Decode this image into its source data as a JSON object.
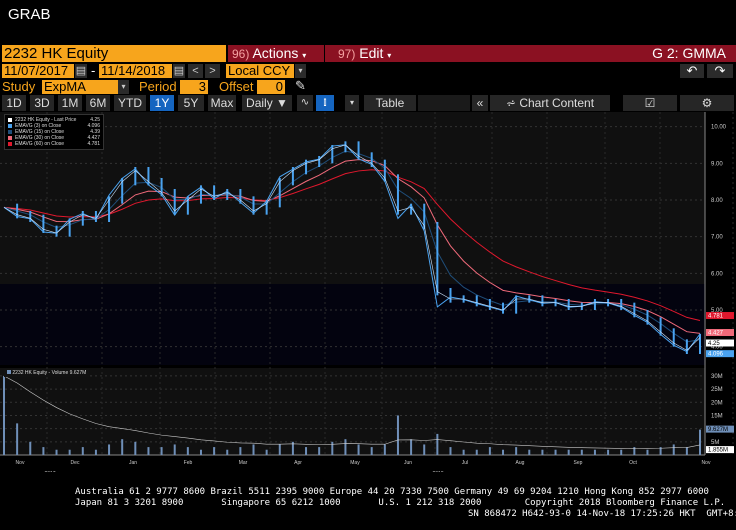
{
  "window_title": "GRAB",
  "security": "2232 HK Equity",
  "menu": {
    "actions_num": "96)",
    "actions": "Actions",
    "edit_num": "97)",
    "edit": "Edit",
    "screen": "G 2: GMMA"
  },
  "dates": {
    "start": "11/07/2017",
    "end": "11/14/2018",
    "currency": "Local CCY"
  },
  "study": {
    "label": "Study",
    "value": "ExpMA",
    "period_label": "Period",
    "period": "3",
    "offset_label": "Offset",
    "offset": "0"
  },
  "toolbar": {
    "ranges": [
      "1D",
      "3D",
      "1M",
      "6M",
      "YTD",
      "1Y",
      "5Y",
      "Max"
    ],
    "selected": "1Y",
    "frequency": "Daily ▼",
    "table": "Table",
    "chart_content": "Chart Content"
  },
  "legend": {
    "items": [
      {
        "label": "2232 HK Equity - Last Price",
        "value": "4.25",
        "color": "#ffffff"
      },
      {
        "label": "EMAVG (3) on Close",
        "value": "4.096",
        "color": "#4aa3f0"
      },
      {
        "label": "EMAVG (15) on Close",
        "value": "4.39",
        "color": "#1f4e7a"
      },
      {
        "label": "EMAVG (30) on Close",
        "value": "4.427",
        "color": "#f06a7a"
      },
      {
        "label": "EMAVG (60) on Close",
        "value": "4.781",
        "color": "#e0182d"
      }
    ]
  },
  "volume_legend": {
    "label": "2232 HK Equity - Volume",
    "value": "9.627M"
  },
  "chart_data": {
    "type": "line",
    "price_axis": {
      "ylim": [
        3.5,
        10.4
      ],
      "ticks": [
        "10.00",
        "9.00",
        "8.00",
        "7.00",
        "6.00",
        "5.00",
        "4.00"
      ]
    },
    "volume_axis": {
      "ylim": [
        0,
        33
      ],
      "ticks": [
        "30M",
        "25M",
        "20M",
        "15M",
        "10M",
        "5M"
      ]
    },
    "x_months": [
      "Nov",
      "Dec",
      "Jan",
      "Feb",
      "Mar",
      "Apr",
      "May",
      "Jun",
      "Jul",
      "Aug",
      "Sep",
      "Oct",
      "Nov"
    ],
    "year_labels": [
      {
        "month": "Nov",
        "year": "2017"
      },
      {
        "month": "Jun",
        "year": "2018"
      }
    ],
    "close": [
      7.8,
      7.6,
      7.5,
      7.2,
      7.1,
      7.4,
      7.6,
      7.5,
      8.0,
      8.5,
      8.8,
      8.5,
      8.2,
      7.7,
      8.0,
      8.3,
      8.1,
      8.2,
      8.0,
      7.7,
      7.9,
      8.5,
      8.8,
      9.0,
      9.1,
      9.4,
      9.5,
      9.2,
      9.0,
      8.6,
      7.7,
      7.8,
      7.3,
      5.5,
      5.3,
      5.3,
      5.2,
      5.1,
      5.0,
      5.3,
      5.3,
      5.2,
      5.2,
      5.1,
      5.1,
      5.2,
      5.2,
      5.1,
      4.9,
      4.7,
      4.4,
      4.1,
      3.9,
      4.25
    ],
    "volume": [
      30,
      12,
      5,
      3,
      2,
      2,
      3,
      2,
      4,
      6,
      5,
      3,
      3,
      4,
      3,
      2,
      3,
      2,
      3,
      4,
      2,
      4,
      5,
      3,
      3,
      5,
      6,
      4,
      3,
      4,
      15,
      6,
      4,
      8,
      3,
      2,
      2,
      3,
      2,
      3,
      2,
      2,
      2,
      2,
      2,
      2,
      2,
      2,
      3,
      2,
      3,
      4,
      3,
      9.627
    ],
    "value_tags": [
      {
        "value": "4.781",
        "color": "#e0182d"
      },
      {
        "value": "4.427",
        "color": "#f06a7a"
      },
      {
        "value": "4.25",
        "color": "#ffffff"
      },
      {
        "value": "4.096",
        "color": "#4aa3f0"
      }
    ],
    "volume_tags": [
      {
        "value": "9.627M",
        "color": "#6f8fb8"
      },
      {
        "value": "1.855M",
        "color": "#ffffff"
      }
    ]
  },
  "footer": {
    "line1": "Australia 61 2 9777 8600 Brazil 5511 2395 9000 Europe 44 20 7330 7500 Germany 49 69 9204 1210 Hong Kong 852 2977 6000",
    "line2": "Japan 81 3 3201 8900       Singapore 65 6212 1000       U.S. 1 212 318 2000        Copyright 2018 Bloomberg Finance L.P.",
    "line3": "SN 868472 H642-93-0 14-Nov-18 17:25:26 HKT  GMT+8:00"
  }
}
